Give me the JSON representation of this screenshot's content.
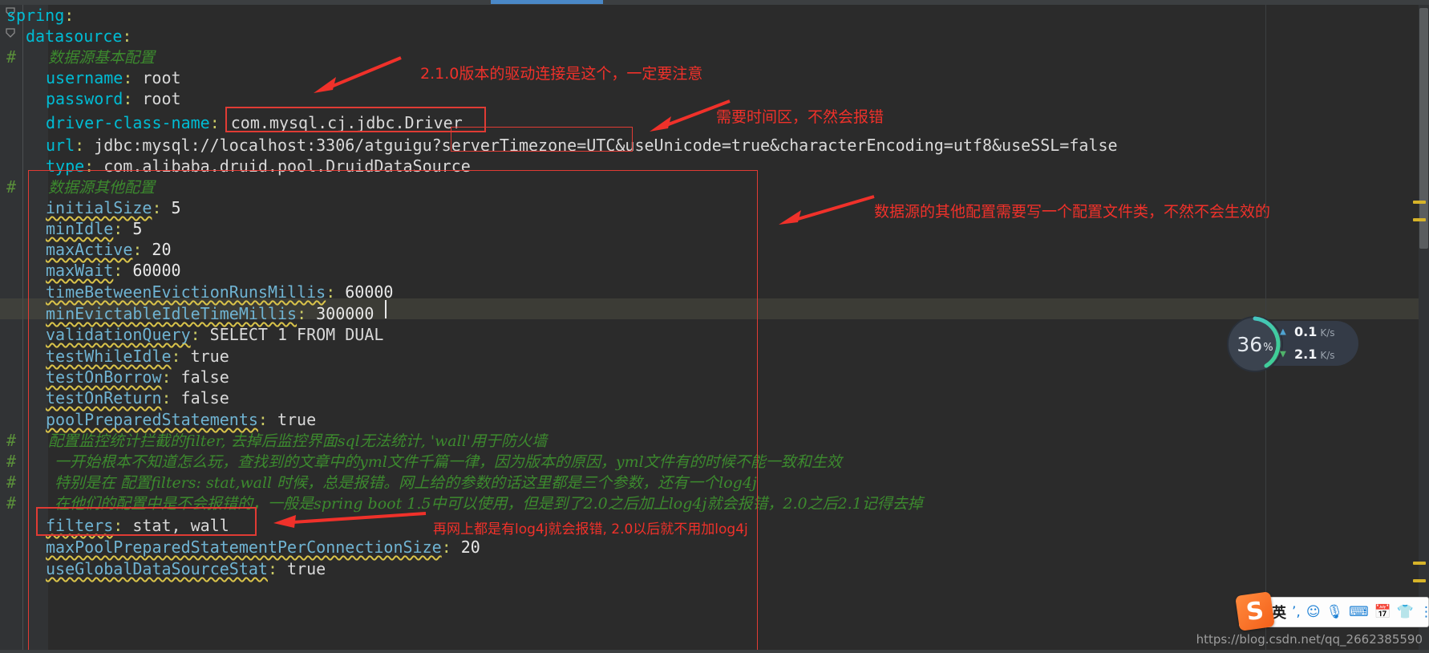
{
  "editor": {
    "language": "yaml",
    "background": "#2b2b2b",
    "gutter_background": "#313335",
    "current_line": 7,
    "lines": [
      {
        "n": 0,
        "indent": 0,
        "hash": "",
        "key": "spring",
        "colon": ":",
        "value": "",
        "type": "key",
        "fold": true
      },
      {
        "n": 1,
        "indent": 1,
        "hash": "",
        "key": "datasource",
        "colon": ":",
        "value": "",
        "type": "key",
        "fold": true
      },
      {
        "n": 2,
        "indent": 2,
        "hash": "#",
        "key": "",
        "colon": "",
        "value": "",
        "type": "comment",
        "comment": "数据源基本配置"
      },
      {
        "n": 3,
        "indent": 2,
        "hash": "",
        "key": "username",
        "colon": ":",
        "value": "root",
        "type": "kv"
      },
      {
        "n": 4,
        "indent": 2,
        "hash": "",
        "key": "password",
        "colon": ":",
        "value": "root",
        "type": "kv"
      },
      {
        "n": 5,
        "indent": 2,
        "hash": "",
        "key": "driver-class-name",
        "colon": ":",
        "value": "com.mysql.cj.jdbc.Driver",
        "type": "kv"
      },
      {
        "n": 6,
        "indent": 2,
        "hash": "",
        "key": "url",
        "colon": ":",
        "value": "jdbc:mysql://localhost:3306/atguigu?serverTimezone=UTC&useUnicode=true&characterEncoding=utf8&useSSL=false",
        "type": "kv"
      },
      {
        "n": 7,
        "indent": 2,
        "hash": "",
        "key": "type",
        "colon": ":",
        "value": "com.alibaba.druid.pool.DruidDataSource",
        "type": "kv"
      },
      {
        "n": 8,
        "indent": 2,
        "hash": "#",
        "key": "",
        "colon": "",
        "value": "",
        "type": "comment",
        "comment": "数据源其他配置"
      },
      {
        "n": 9,
        "indent": 3,
        "hash": "",
        "key": "initialSize",
        "colon": ":",
        "value": "5",
        "type": "kv",
        "wavy": true
      },
      {
        "n": 10,
        "indent": 3,
        "hash": "",
        "key": "minIdle",
        "colon": ":",
        "value": "5",
        "type": "kv",
        "wavy": true
      },
      {
        "n": 11,
        "indent": 3,
        "hash": "",
        "key": "maxActive",
        "colon": ":",
        "value": "20",
        "type": "kv",
        "wavy": true
      },
      {
        "n": 12,
        "indent": 3,
        "hash": "",
        "key": "maxWait",
        "colon": ":",
        "value": "60000",
        "type": "kv",
        "wavy": true
      },
      {
        "n": 13,
        "indent": 3,
        "hash": "",
        "key": "timeBetweenEvictionRunsMillis",
        "colon": ":",
        "value": "60000",
        "type": "kv",
        "wavy": true
      },
      {
        "n": 14,
        "indent": 3,
        "hash": "",
        "key": "minEvictableIdleTimeMillis",
        "colon": ":",
        "value": "300000",
        "type": "kv",
        "wavy": true,
        "caret": true,
        "highlight": true
      },
      {
        "n": 15,
        "indent": 3,
        "hash": "",
        "key": "validationQuery",
        "colon": ":",
        "value": "SELECT 1 FROM DUAL",
        "type": "kv",
        "wavy": true
      },
      {
        "n": 16,
        "indent": 3,
        "hash": "",
        "key": "testWhileIdle",
        "colon": ":",
        "value": "true",
        "type": "kv",
        "wavy": true
      },
      {
        "n": 17,
        "indent": 3,
        "hash": "",
        "key": "testOnBorrow",
        "colon": ":",
        "value": "false",
        "type": "kv",
        "wavy": true
      },
      {
        "n": 18,
        "indent": 3,
        "hash": "",
        "key": "testOnReturn",
        "colon": ":",
        "value": "false",
        "type": "kv",
        "wavy": true
      },
      {
        "n": 19,
        "indent": 3,
        "hash": "",
        "key": "poolPreparedStatements",
        "colon": ":",
        "value": "true",
        "type": "kv",
        "wavy": true
      },
      {
        "n": 20,
        "indent": 2,
        "hash": "#",
        "key": "",
        "colon": "",
        "value": "",
        "type": "comment",
        "comment": "配置监控统计拦截的filter, 去掉后监控界面sql无法统计, 'wall'用于防火墙"
      },
      {
        "n": 21,
        "indent": 2,
        "hash": "#",
        "key": "",
        "colon": "",
        "value": "",
        "type": "comment",
        "comment": "一开始根本不知道怎么玩，查找到的文章中的yml文件千篇一律，因为版本的原因，yml文件有的时候不能一致和生效"
      },
      {
        "n": 22,
        "indent": 2,
        "hash": "#",
        "key": "",
        "colon": "",
        "value": "",
        "type": "comment",
        "comment": "特别是在 配置filters: stat,wall 时候，总是报错。网上给的参数的话这里都是三个参数，还有一个log4j"
      },
      {
        "n": 23,
        "indent": 2,
        "hash": "#",
        "key": "",
        "colon": "",
        "value": "",
        "type": "comment",
        "comment": "在他们的配置中是不会报错的，一般是spring boot 1.5中可以使用，但是到了2.0之后加上log4j就会报错，2.0之后2.1记得去掉"
      },
      {
        "n": 24,
        "indent": 3,
        "hash": "",
        "key": "filters",
        "colon": ":",
        "value": "stat, wall",
        "type": "kv",
        "wavy": true
      },
      {
        "n": 25,
        "indent": 3,
        "hash": "",
        "key": "maxPoolPreparedStatementPerConnectionSize",
        "colon": ":",
        "value": "20",
        "type": "kv",
        "wavy": true
      },
      {
        "n": 26,
        "indent": 3,
        "hash": "",
        "key": "useGlobalDataSourceStat",
        "colon": ":",
        "value": "true",
        "type": "kv",
        "wavy": true
      }
    ]
  },
  "annotations": [
    {
      "id": "a1",
      "text": "2.1.0版本的驱动连接是这个，一定要注意"
    },
    {
      "id": "a2",
      "text": "需要时间区，不然会报错"
    },
    {
      "id": "a3",
      "text": "数据源的其他配置需要写一个配置文件类，不然不会生效的"
    },
    {
      "id": "a4",
      "text": "再网上都是有log4j就会报错, 2.0以后就不用加log4j"
    }
  ],
  "highlight_boxes": [
    {
      "id": "box-driver-value",
      "label": "com.mysql.cj.jdbc.Driver"
    },
    {
      "id": "box-timezone",
      "label": "serverTimezone=UTC"
    },
    {
      "id": "box-other-config",
      "label": "数据源其他配置区块"
    },
    {
      "id": "box-filters",
      "label": "filters: stat, wall"
    }
  ],
  "net_widget": {
    "name": "network-speed-monitor",
    "cpu_percent": "36",
    "percent_symbol": "%",
    "upload_value": "0.1",
    "upload_unit": "K/s",
    "download_value": "2.1",
    "download_unit": "K/s",
    "ring_color": "#3ecf8e",
    "ring_color2": "#46c5c0"
  },
  "ime_bar": {
    "logo": "S",
    "mode": "英",
    "items": [
      "punctuation-icon",
      "emoji-icon",
      "microphone-icon",
      "keyboard-icon",
      "calendar-icon",
      "skin-icon",
      "menu-icon"
    ]
  },
  "watermark": "https://blog.csdn.net/qq_2662385590",
  "colors": {
    "accent_red": "#f0312a",
    "key_cyan": "#6fb3d2",
    "comment_green": "#3c8a2e",
    "value_white": "#d9d9d9",
    "wavy_yellow": "#d9c34a",
    "highlight_line": "#4a4a3f"
  }
}
